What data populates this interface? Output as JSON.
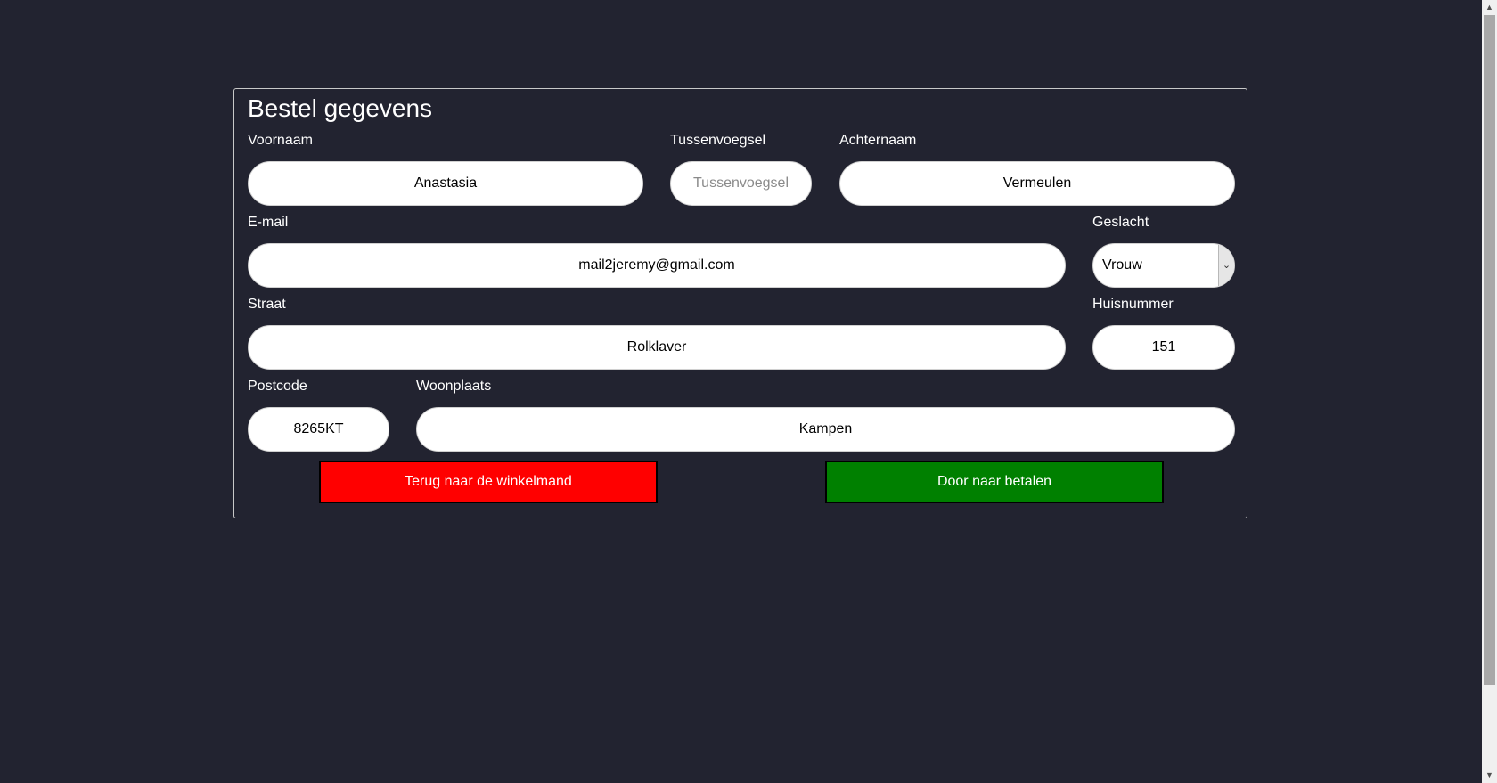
{
  "form": {
    "title": "Bestel gegevens",
    "voornaam": {
      "label": "Voornaam",
      "value": "Anastasia"
    },
    "tussenvoegsel": {
      "label": "Tussenvoegsel",
      "value": "",
      "placeholder": "Tussenvoegsel"
    },
    "achternaam": {
      "label": "Achternaam",
      "value": "Vermeulen"
    },
    "email": {
      "label": "E-mail",
      "value": "mail2jeremy@gmail.com"
    },
    "geslacht": {
      "label": "Geslacht",
      "value": "Vrouw",
      "arrow_icon": "chevron-down-icon"
    },
    "straat": {
      "label": "Straat",
      "value": "Rolklaver"
    },
    "huisnummer": {
      "label": "Huisnummer",
      "value": "151"
    },
    "postcode": {
      "label": "Postcode",
      "value": "8265KT"
    },
    "woonplaats": {
      "label": "Woonplaats",
      "value": "Kampen"
    }
  },
  "buttons": {
    "back_label": "Terug naar de winkelmand",
    "next_label": "Door naar betalen"
  },
  "colors": {
    "background": "#222330",
    "back_button": "#ff0000",
    "next_button": "#008000"
  }
}
